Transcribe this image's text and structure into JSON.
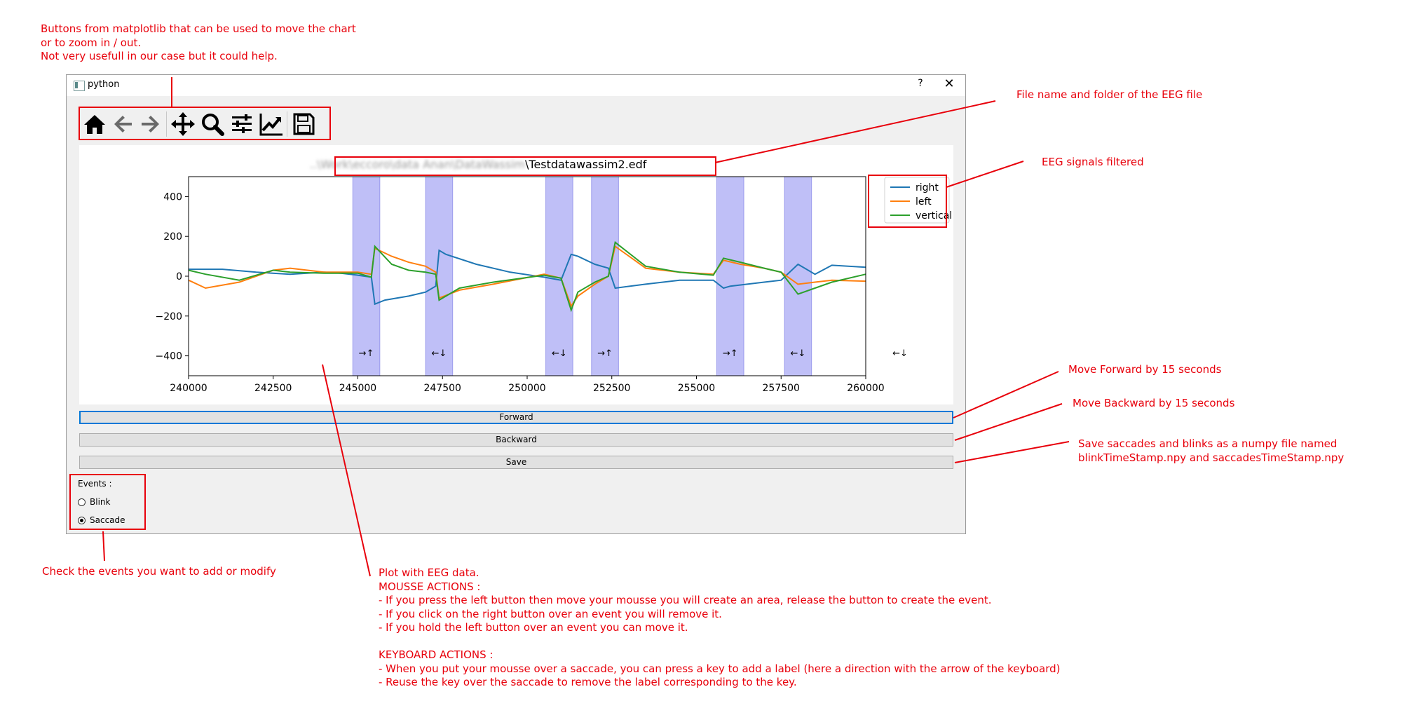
{
  "window": {
    "title": "python",
    "help_glyph": "?",
    "close_glyph": "✕"
  },
  "toolbar": {
    "buttons": [
      "home-icon",
      "back-arrow-icon",
      "forward-arrow-icon",
      "pan-move-icon",
      "zoom-magnifier-icon",
      "configure-subplots-icon",
      "edit-axis-icon",
      "save-figure-icon"
    ]
  },
  "plot": {
    "title_visible": "\\Testdatawassim2.edf",
    "title_blurred": "..\\Work\\eccoro\\data Anan\\DataWassim"
  },
  "chart_data": {
    "type": "line",
    "title": "..\\Work\\eccoro\\data Anan\\DataWassim\\Testdatawassim2.edf",
    "xlim": [
      240000,
      260000
    ],
    "ylim": [
      -500,
      500
    ],
    "x_ticks": [
      "240000",
      "242500",
      "245000",
      "247500",
      "250000",
      "252500",
      "255000",
      "257500",
      "260000"
    ],
    "y_ticks": [
      "400",
      "200",
      "0",
      "−200",
      "−400"
    ],
    "grid": false,
    "legend_position": "upper right outside",
    "colors": {
      "right": "#1f77b4",
      "left": "#ff7f0e",
      "vertical": "#2ca02c",
      "span": "#0000ff"
    },
    "series": [
      {
        "name": "right",
        "x": [
          240000,
          241000,
          242000,
          243000,
          244000,
          244500,
          245000,
          245400,
          245500,
          245800,
          246500,
          247000,
          247300,
          247400,
          247600,
          248500,
          249500,
          250500,
          251000,
          251300,
          251500,
          252000,
          252400,
          252600,
          253500,
          254500,
          255500,
          255800,
          256000,
          257000,
          257500,
          258000,
          258500,
          259000,
          260000
        ],
        "y": [
          35,
          35,
          20,
          10,
          20,
          15,
          5,
          -5,
          -140,
          -120,
          -100,
          -80,
          -50,
          130,
          110,
          60,
          20,
          -5,
          -20,
          110,
          100,
          60,
          40,
          -60,
          -40,
          -20,
          -20,
          -60,
          -50,
          -30,
          -20,
          60,
          10,
          55,
          45
        ]
      },
      {
        "name": "left",
        "x": [
          240000,
          240500,
          241500,
          242500,
          243000,
          244000,
          245000,
          245400,
          245500,
          246000,
          246500,
          247000,
          247300,
          247400,
          248000,
          249000,
          250500,
          251000,
          251300,
          251500,
          252000,
          252400,
          252600,
          253500,
          254500,
          255500,
          255800,
          256300,
          257000,
          257500,
          258000,
          258500,
          259000,
          260000
        ],
        "y": [
          -20,
          -60,
          -30,
          30,
          40,
          20,
          20,
          10,
          140,
          100,
          70,
          50,
          20,
          -110,
          -70,
          -40,
          10,
          -10,
          -150,
          -100,
          -40,
          0,
          150,
          40,
          20,
          10,
          80,
          60,
          40,
          20,
          -40,
          -30,
          -20,
          -25
        ]
      },
      {
        "name": "vertical",
        "x": [
          240000,
          240500,
          241500,
          242500,
          243000,
          244000,
          245000,
          245400,
          245500,
          246000,
          246500,
          247000,
          247300,
          247400,
          248000,
          249000,
          250500,
          251000,
          251300,
          251500,
          252000,
          252400,
          252600,
          253500,
          254500,
          255500,
          255800,
          256300,
          257000,
          257500,
          258000,
          258500,
          259000,
          260000
        ],
        "y": [
          30,
          10,
          -20,
          30,
          20,
          15,
          15,
          -5,
          150,
          60,
          30,
          20,
          10,
          -120,
          -60,
          -30,
          5,
          -10,
          -170,
          -80,
          -30,
          0,
          170,
          50,
          20,
          5,
          90,
          70,
          40,
          20,
          -90,
          -60,
          -30,
          10
        ]
      }
    ],
    "event_spans": [
      {
        "x0": 244850,
        "x1": 245650,
        "label": "→↑"
      },
      {
        "x0": 247000,
        "x1": 247800,
        "label": "←↓"
      },
      {
        "x0": 250550,
        "x1": 251350,
        "label": "←↓"
      },
      {
        "x0": 251900,
        "x1": 252700,
        "label": "→↑"
      },
      {
        "x0": 255600,
        "x1": 256400,
        "label": "→↑"
      },
      {
        "x0": 257600,
        "x1": 258400,
        "label": "←↓"
      }
    ],
    "outside_label": "←↓"
  },
  "controls": {
    "forward": "Forward",
    "backward": "Backward",
    "save": "Save",
    "events_label": "Events :",
    "blink": "Blink",
    "saccade": "Saccade",
    "selected": "Saccade"
  },
  "annotations": {
    "toolbar": "Buttons from matplotlib that can be used to move the chart\nor to zoom in / out.\nNot very usefull in our case but it could help.",
    "filename": "File name and folder of the EEG file",
    "legend": "EEG signals filtered",
    "forward": "Move Forward by 15 seconds",
    "backward": "Move Backward by 15 seconds",
    "save": "Save saccades and blinks as a numpy file named\nblinkTimeStamp.npy and saccadesTimeStamp.npy",
    "events": "Check the events you want to add or modify",
    "plot": "Plot with EEG data.\nMOUSSE ACTIONS :\n- If you press the left button then move your mousse you will create an area, release the button to create the event.\n- If you click on the right button over an event you will remove it.\n- If you hold the left button over an event you can move it.\n\nKEYBOARD ACTIONS :\n- When you put your mousse over a saccade, you can press a key to add a label (here a direction with the arrow of the keyboard)\n- Reuse the key over the saccade to remove the label corresponding to the key."
  }
}
